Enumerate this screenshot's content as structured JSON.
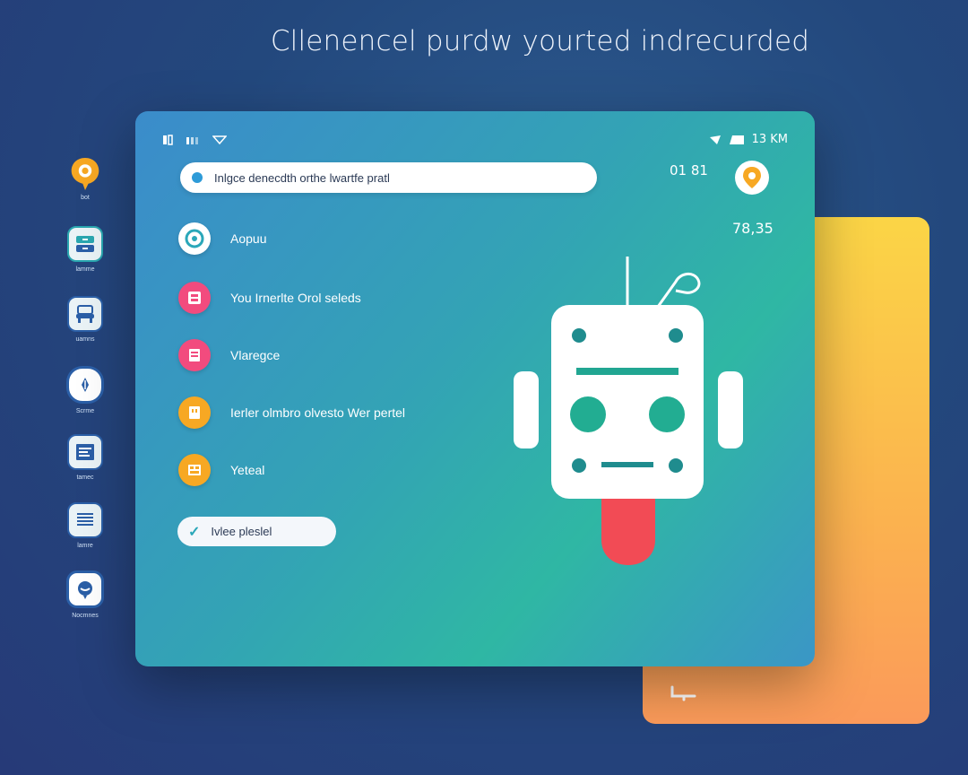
{
  "headline": "Cllenencel purdw yourted indrecurded",
  "dock": {
    "items": [
      {
        "label": "bot",
        "icon": "chat-bubble-icon",
        "color": "#f7a823"
      },
      {
        "label": "lamme",
        "icon": "cabinet-icon",
        "color": "#2aa7b0"
      },
      {
        "label": "uamns",
        "icon": "chair-icon",
        "color": "#2b5fa7"
      },
      {
        "label": "Scrme",
        "icon": "pen-circle-icon",
        "color": "#2b5fa7"
      },
      {
        "label": "tamec",
        "icon": "document-icon",
        "color": "#2b5fa7"
      },
      {
        "label": "lamre",
        "icon": "list-icon",
        "color": "#2b5fa7"
      },
      {
        "label": "Nocmnes",
        "icon": "speech-icon",
        "color": "#2b5fa7"
      }
    ]
  },
  "status": {
    "right_text": "13 KM"
  },
  "search": {
    "text": "Inlgce denecdth orthe lwartfe pratl"
  },
  "time": "01 81",
  "stat": "78,35",
  "menu": [
    {
      "label": "Aopuu",
      "color": "#ffffff",
      "icon": "ring-icon"
    },
    {
      "label": "You Irnerlte Orol seleds",
      "color": "#f24b7e",
      "icon": "tray-icon"
    },
    {
      "label": "Vlaregce",
      "color": "#f24b7e",
      "icon": "locker-icon"
    },
    {
      "label": "Ierler olmbro olvesto Wer pertel",
      "color": "#f7a823",
      "icon": "box-icon"
    },
    {
      "label": "Yeteal",
      "color": "#f7a823",
      "icon": "grid-icon"
    }
  ],
  "pill": {
    "text": "Ivlee pleslel"
  },
  "colors": {
    "accent": "#2fb7a4",
    "robot_tongue": "#f24b55",
    "back_card": "#fbc34d"
  }
}
